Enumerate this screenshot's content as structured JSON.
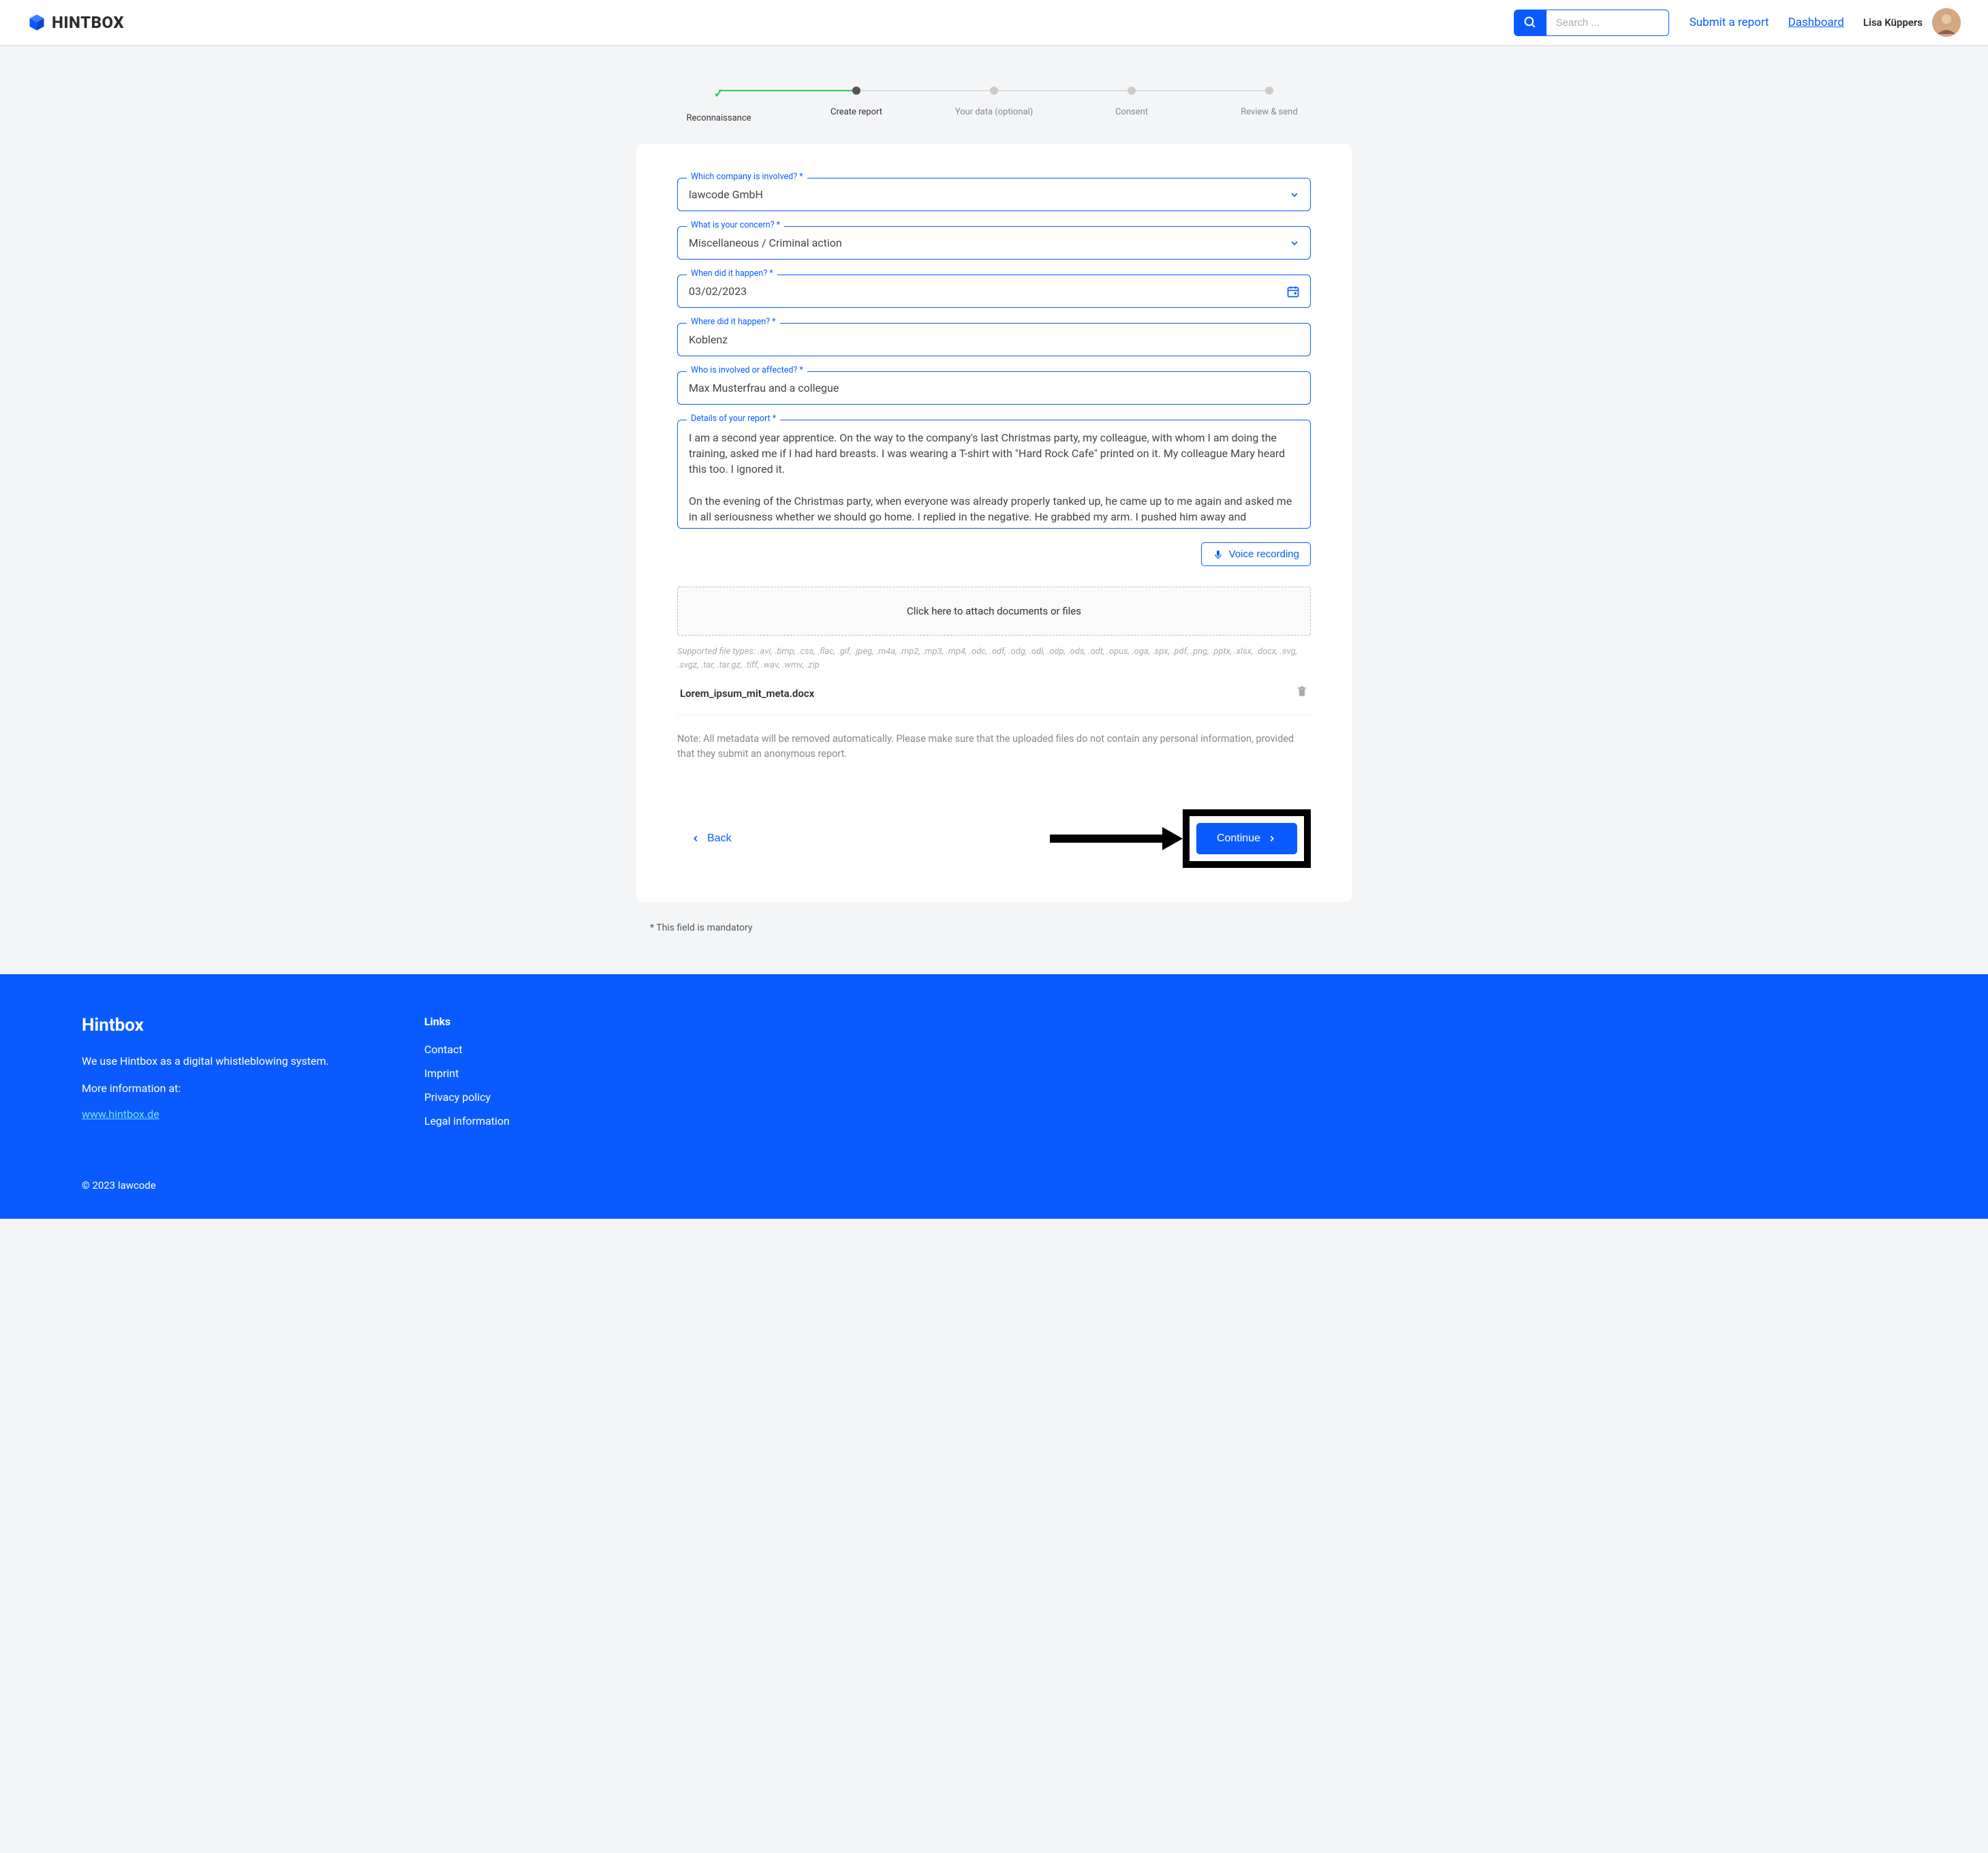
{
  "header": {
    "brand": "HINTBOX",
    "search_placeholder": "Search ...",
    "submit_link": "Submit a report",
    "dashboard_link": "Dashboard",
    "user_name": "Lisa Küppers"
  },
  "stepper": {
    "steps": [
      {
        "label": "Reconnaissance"
      },
      {
        "label": "Create report"
      },
      {
        "label": "Your data (optional)"
      },
      {
        "label": "Consent"
      },
      {
        "label": "Review & send"
      }
    ]
  },
  "form": {
    "company": {
      "label": "Which company is involved? *",
      "value": "lawcode GmbH"
    },
    "concern": {
      "label": "What is your concern? *",
      "value": "Miscellaneous / Criminal action"
    },
    "when": {
      "label": "When did it happen? *",
      "value": "03/02/2023"
    },
    "where": {
      "label": "Where did it happen? *",
      "value": "Koblenz"
    },
    "who": {
      "label": "Who is involved or affected? *",
      "value": "Max Musterfrau and a collegue"
    },
    "details": {
      "label": "Details of your report *",
      "value": "I am a second year apprentice. On the way to the company's last Christmas party, my colleague, with whom I am doing the training, asked me if I had hard breasts. I was wearing a T-shirt with \"Hard Rock Cafe\" printed on it. My colleague Mary heard this too. I ignored it.\n\nOn the evening of the Christmas party, when everyone was already properly tanked up, he came up to me again and asked me in all seriousness whether we should go home. I replied in the negative. He grabbed my arm. I pushed him away and immediately went home."
    },
    "voice_btn": "Voice recording",
    "dropzone": "Click here to attach documents or files",
    "filetypes": "Supported file types: .avi, .bmp, .css, .flac, .gif, .jpeg, .m4a, .mp2, .mp3, .mp4, .odc, .odf, .odg, .odi, .odp, .ods, .odt, .opus, .oga, .spx, .pdf, .png, .pptx, .xlsx, .docx, .svg, .svgz, .tar, .tar.gz, .tiff, .wav, .wmv, .zip",
    "uploaded_file": "Lorem_ipsum_mit_meta.docx",
    "note": "Note: All metadata will be removed automatically. Please make sure that the uploaded files do not contain any personal information, provided that they submit an anonymous report.",
    "back_btn": "Back",
    "continue_btn": "Continue"
  },
  "mandatory_note": "* This field is mandatory",
  "footer": {
    "brand": "Hintbox",
    "desc": "We use Hintbox as a digital whistleblowing system.",
    "more_info": "More information at:",
    "url": "www.hintbox.de",
    "links_heading": "Links",
    "links": [
      "Contact",
      "Imprint",
      "Privacy policy",
      "Legal information"
    ],
    "copyright": "© 2023 lawcode"
  }
}
